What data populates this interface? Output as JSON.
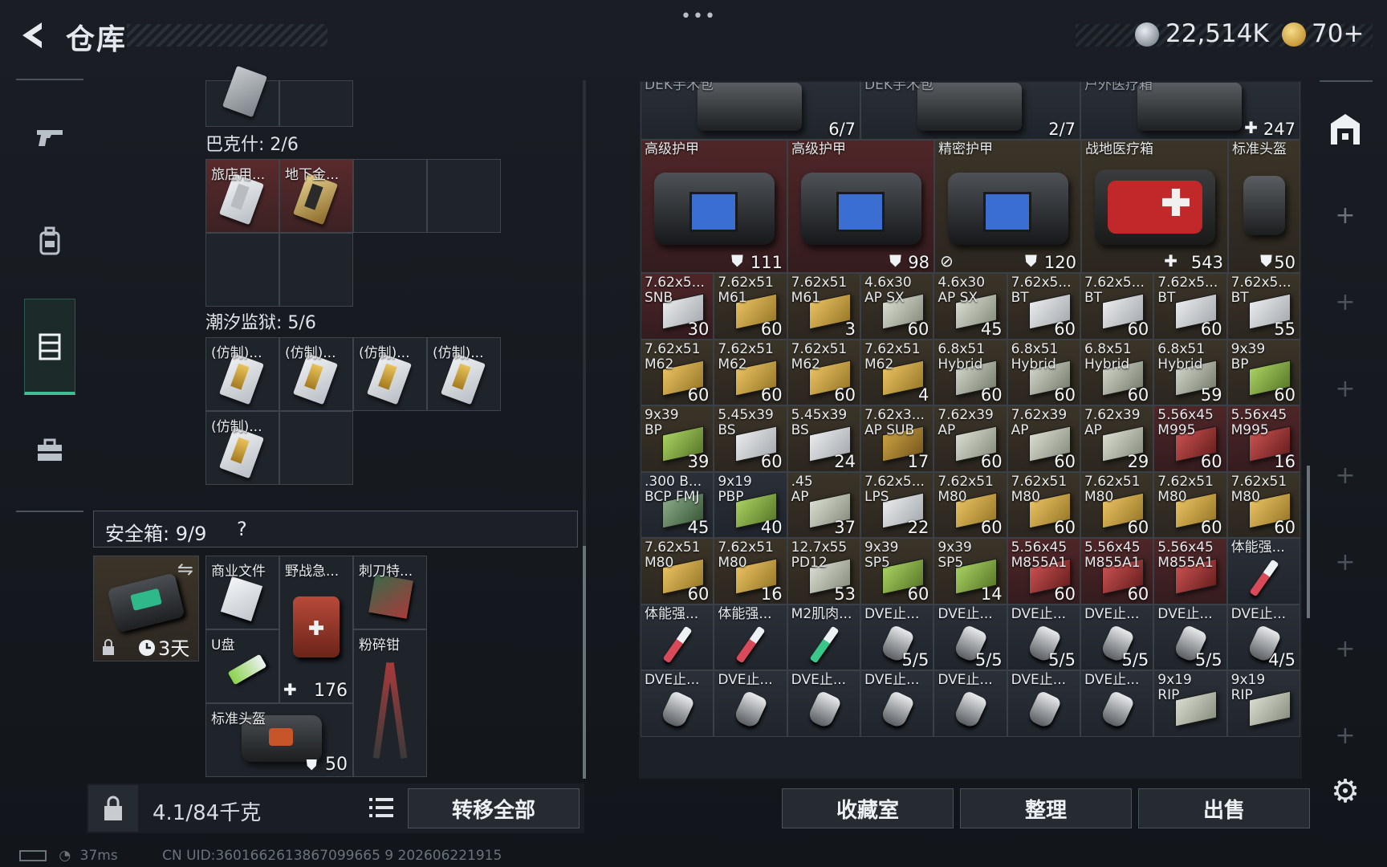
{
  "header": {
    "title": "仓库",
    "currency1": "22,514K",
    "currency2": "70+"
  },
  "left": {
    "section1_label": "巴克什: 2/6",
    "section2_label": "潮汐监狱: 5/6",
    "bakshi_items": [
      {
        "label": "旅店用..."
      },
      {
        "label": "地下金..."
      }
    ],
    "prison_items": [
      {
        "label": "(仿制)..."
      },
      {
        "label": "(仿制)..."
      },
      {
        "label": "(仿制)..."
      },
      {
        "label": "(仿制)..."
      },
      {
        "label": "(仿制)..."
      }
    ],
    "safebox_label": "安全箱: 9/9",
    "safebox_help": "?",
    "case_timer": "3天",
    "safebox_items": [
      {
        "label": "商业文件"
      },
      {
        "label": "野战急...",
        "count": "176"
      },
      {
        "label": "刺刀特..."
      },
      {
        "label": "U盘"
      },
      {
        "label": "粉碎钳"
      },
      {
        "label": "标准头盔",
        "count": "50"
      }
    ],
    "weight": "4.1/84千克",
    "transfer_all": "转移全部"
  },
  "right": {
    "top_row": [
      {
        "label": "DEK手术包",
        "count": "6/7"
      },
      {
        "label": "DEK手术包",
        "count": "2/7"
      },
      {
        "label": "户外医疗箱",
        "count": "247"
      }
    ],
    "big_row": [
      {
        "label": "高级护甲",
        "count": "111"
      },
      {
        "label": "高级护甲",
        "count": "98"
      },
      {
        "label": "精密护甲",
        "count": "120"
      },
      {
        "label": "战地医疗箱",
        "count": "543"
      },
      {
        "label": "标准头盔",
        "count": "50"
      }
    ],
    "ammo_rows": [
      [
        {
          "l1": "7.62x5...",
          "l2": "SNB",
          "c": "30"
        },
        {
          "l1": "7.62x51",
          "l2": "M61",
          "c": "60"
        },
        {
          "l1": "7.62x51",
          "l2": "M61",
          "c": "3"
        },
        {
          "l1": "4.6x30",
          "l2": "AP SX",
          "c": "60"
        },
        {
          "l1": "4.6x30",
          "l2": "AP SX",
          "c": "45"
        },
        {
          "l1": "7.62x5...",
          "l2": "BT",
          "c": "60"
        },
        {
          "l1": "7.62x5...",
          "l2": "BT",
          "c": "60"
        },
        {
          "l1": "7.62x5...",
          "l2": "BT",
          "c": "60"
        },
        {
          "l1": "7.62x5...",
          "l2": "BT",
          "c": "55"
        }
      ],
      [
        {
          "l1": "7.62x51",
          "l2": "M62",
          "c": "60"
        },
        {
          "l1": "7.62x51",
          "l2": "M62",
          "c": "60"
        },
        {
          "l1": "7.62x51",
          "l2": "M62",
          "c": "60"
        },
        {
          "l1": "7.62x51",
          "l2": "M62",
          "c": "4"
        },
        {
          "l1": "6.8x51",
          "l2": "Hybrid",
          "c": "60"
        },
        {
          "l1": "6.8x51",
          "l2": "Hybrid",
          "c": "60"
        },
        {
          "l1": "6.8x51",
          "l2": "Hybrid",
          "c": "60"
        },
        {
          "l1": "6.8x51",
          "l2": "Hybrid",
          "c": "59"
        },
        {
          "l1": "9x39",
          "l2": "BP",
          "c": "60"
        }
      ],
      [
        {
          "l1": "9x39",
          "l2": "BP",
          "c": "39"
        },
        {
          "l1": "5.45x39",
          "l2": "BS",
          "c": "60"
        },
        {
          "l1": "5.45x39",
          "l2": "BS",
          "c": "24"
        },
        {
          "l1": "7.62x3...",
          "l2": "AP SUB",
          "c": "17"
        },
        {
          "l1": "7.62x39",
          "l2": "AP",
          "c": "60"
        },
        {
          "l1": "7.62x39",
          "l2": "AP",
          "c": "60"
        },
        {
          "l1": "7.62x39",
          "l2": "AP",
          "c": "29"
        },
        {
          "l1": "5.56x45",
          "l2": "M995",
          "c": "60"
        },
        {
          "l1": "5.56x45",
          "l2": "M995",
          "c": "16"
        }
      ],
      [
        {
          "l1": ".300 B...",
          "l2": "BCP FMJ",
          "c": "45"
        },
        {
          "l1": "9x19",
          "l2": "PBP",
          "c": "40"
        },
        {
          "l1": ".45",
          "l2": "AP",
          "c": "37"
        },
        {
          "l1": "7.62x5...",
          "l2": "LPS",
          "c": "22"
        },
        {
          "l1": "7.62x51",
          "l2": "M80",
          "c": "60"
        },
        {
          "l1": "7.62x51",
          "l2": "M80",
          "c": "60"
        },
        {
          "l1": "7.62x51",
          "l2": "M80",
          "c": "60"
        },
        {
          "l1": "7.62x51",
          "l2": "M80",
          "c": "60"
        },
        {
          "l1": "7.62x51",
          "l2": "M80",
          "c": "60"
        }
      ],
      [
        {
          "l1": "7.62x51",
          "l2": "M80",
          "c": "60"
        },
        {
          "l1": "7.62x51",
          "l2": "M80",
          "c": "16"
        },
        {
          "l1": "12.7x55",
          "l2": "PD12",
          "c": "53"
        },
        {
          "l1": "9x39",
          "l2": "SP5",
          "c": "60"
        },
        {
          "l1": "9x39",
          "l2": "SP5",
          "c": "14"
        },
        {
          "l1": "5.56x45",
          "l2": "M855A1",
          "c": "60"
        },
        {
          "l1": "5.56x45",
          "l2": "M855A1",
          "c": "60"
        },
        {
          "l1": "5.56x45",
          "l2": "M855A1",
          "c": ""
        },
        {
          "l1": "体能强...",
          "l2": "",
          "c": ""
        }
      ],
      [
        {
          "l1": "体能强...",
          "l2": "",
          "c": ""
        },
        {
          "l1": "体能强...",
          "l2": "",
          "c": ""
        },
        {
          "l1": "M2肌肉...",
          "l2": "",
          "c": ""
        },
        {
          "l1": "DVE止...",
          "l2": "",
          "c": "5/5"
        },
        {
          "l1": "DVE止...",
          "l2": "",
          "c": "5/5"
        },
        {
          "l1": "DVE止...",
          "l2": "",
          "c": "5/5"
        },
        {
          "l1": "DVE止...",
          "l2": "",
          "c": "5/5"
        },
        {
          "l1": "DVE止...",
          "l2": "",
          "c": "5/5"
        },
        {
          "l1": "DVE止...",
          "l2": "",
          "c": "4/5"
        }
      ],
      [
        {
          "l1": "DVE止...",
          "l2": "",
          "c": ""
        },
        {
          "l1": "DVE止...",
          "l2": "",
          "c": ""
        },
        {
          "l1": "DVE止...",
          "l2": "",
          "c": ""
        },
        {
          "l1": "DVE止...",
          "l2": "",
          "c": ""
        },
        {
          "l1": "DVE止...",
          "l2": "",
          "c": ""
        },
        {
          "l1": "DVE止...",
          "l2": "",
          "c": ""
        },
        {
          "l1": "DVE止...",
          "l2": "",
          "c": ""
        },
        {
          "l1": "9x19",
          "l2": "RIP",
          "c": ""
        },
        {
          "l1": "9x19",
          "l2": "RIP",
          "c": ""
        }
      ]
    ],
    "buttons": {
      "collection": "收藏室",
      "sort": "整理",
      "sell": "出售"
    }
  },
  "status": {
    "ping": "37ms",
    "uid": "CN UID:3601662613867099665 9 202606221915"
  },
  "colors": {
    "accent": "#3fbf95",
    "red_cell": "#4f2628",
    "brown_cell": "#3b3428"
  }
}
